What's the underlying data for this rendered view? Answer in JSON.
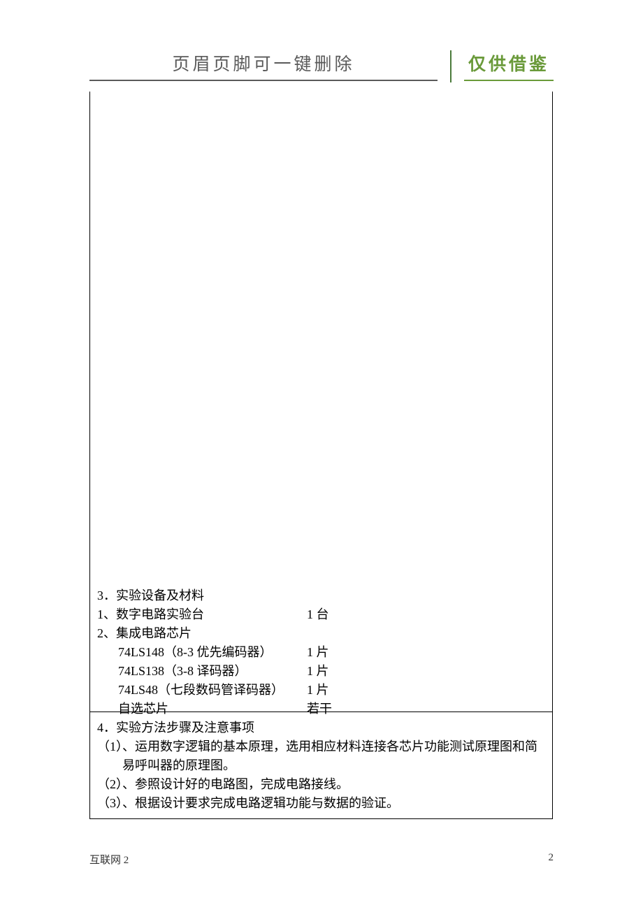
{
  "header": {
    "left": "页眉页脚可一键删除",
    "right": "仅供借鉴"
  },
  "section3": {
    "title": "3．实验设备及材料",
    "items": [
      {
        "label": "1、数字电路实验台",
        "qty": "1 台",
        "indent": 0
      },
      {
        "label": "2、集成电路芯片",
        "qty": "",
        "indent": 0
      },
      {
        "label": "74LS148（8-3 优先编码器）",
        "qty": "1 片",
        "indent": 1
      },
      {
        "label": "74LS138（3-8 译码器）",
        "qty": "1 片",
        "indent": 1
      },
      {
        "label": "74LS48（七段数码管译码器）",
        "qty": "1 片",
        "indent": 1
      },
      {
        "label": "自选芯片",
        "qty": "若干",
        "indent": 1
      }
    ]
  },
  "section4": {
    "title": "4．实验方法步骤及注意事项",
    "lines": [
      "（1）、运用数字逻辑的基本原理，选用相应材料连接各芯片功能测试原理图和简",
      "易呼叫器的原理图。",
      "（2）、参照设计好的电路图，完成电路接线。",
      "（3）、根据设计要求完成电路逻辑功能与数据的验证。"
    ],
    "contIndex": 1
  },
  "footer": {
    "left": "互联网 2",
    "right": "2"
  }
}
